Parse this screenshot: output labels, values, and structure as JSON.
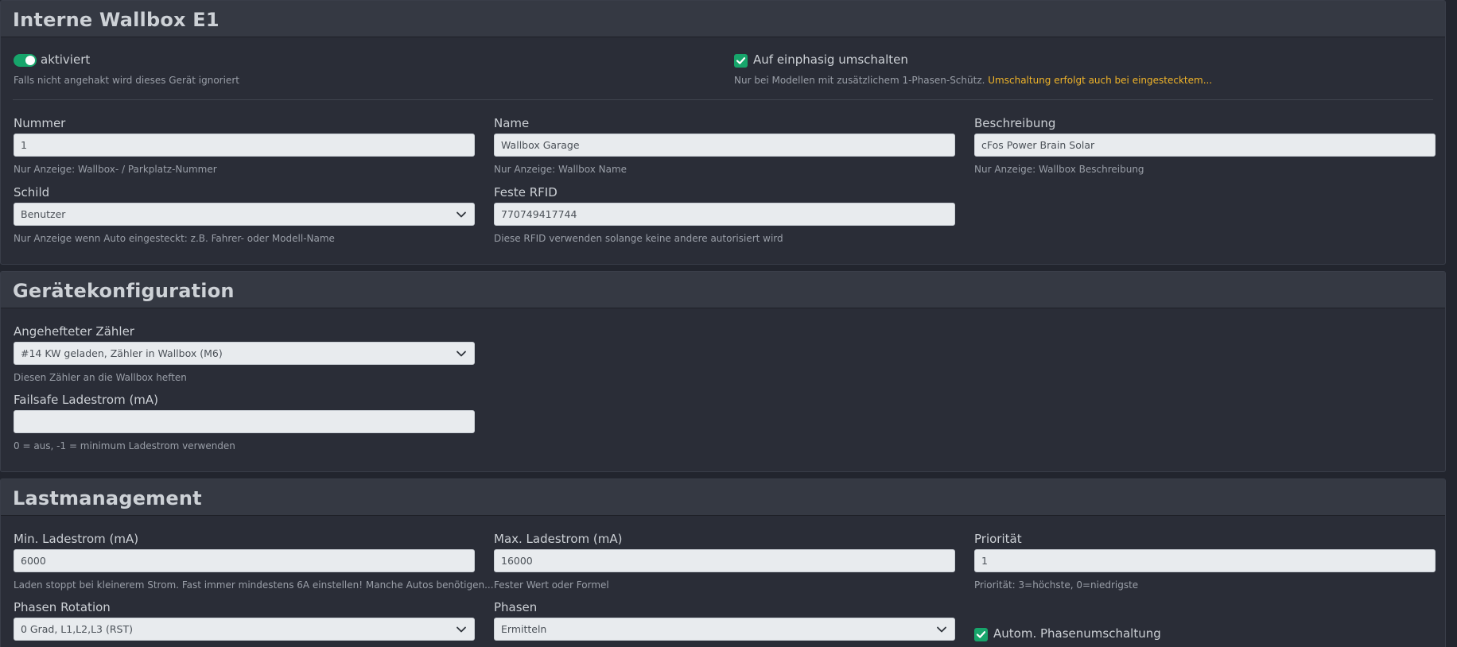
{
  "section1": {
    "title": "Interne Wallbox E1",
    "enabled": {
      "label": "aktiviert",
      "hint": "Falls nicht angehakt wird dieses Gerät ignoriert",
      "checked": true
    },
    "single_phase": {
      "label": "Auf einphasig umschalten",
      "hint": "Nur bei Modellen mit zusätzlichem 1-Phasen-Schütz.",
      "hint_warning": "Umschaltung erfolgt auch bei eingestecktem...",
      "checked": true
    },
    "nummer": {
      "label": "Nummer",
      "value": "1",
      "hint": "Nur Anzeige: Wallbox- / Parkplatz-Nummer"
    },
    "name": {
      "label": "Name",
      "value": "Wallbox Garage",
      "hint": "Nur Anzeige: Wallbox Name"
    },
    "beschreibung": {
      "label": "Beschreibung",
      "value": "cFos Power Brain Solar",
      "hint": "Nur Anzeige: Wallbox Beschreibung"
    },
    "schild": {
      "label": "Schild",
      "value": "Benutzer",
      "hint": "Nur Anzeige wenn Auto eingesteckt: z.B. Fahrer- oder Modell-Name"
    },
    "rfid": {
      "label": "Feste RFID",
      "value": "770749417744",
      "hint": "Diese RFID verwenden solange keine andere autorisiert wird"
    }
  },
  "section2": {
    "title": "Gerätekonfiguration",
    "meter": {
      "label": "Angehefteter Zähler",
      "value": "#14 KW geladen, Zähler in Wallbox (M6)",
      "hint": "Diesen Zähler an die Wallbox heften"
    },
    "failsafe": {
      "label": "Failsafe Ladestrom (mA)",
      "value": "",
      "hint": "0 = aus, -1 = minimum Ladestrom verwenden"
    }
  },
  "section3": {
    "title": "Lastmanagement",
    "min_current": {
      "label": "Min. Ladestrom (mA)",
      "value": "6000",
      "hint": "Laden stoppt bei kleinerem Strom. Fast immer mindestens 6A einstellen! Manche Autos benötigen..."
    },
    "max_current": {
      "label": "Max. Ladestrom (mA)",
      "value": "16000",
      "hint": "Fester Wert oder Formel"
    },
    "priority": {
      "label": "Priorität",
      "value": "1",
      "hint": "Priorität: 3=höchste, 0=niedrigste"
    },
    "phase_rotation": {
      "label": "Phasen Rotation",
      "value": "0 Grad, L1,L2,L3 (RST)"
    },
    "phases": {
      "label": "Phasen",
      "value": "Ermitteln"
    },
    "auto_phase_switch": {
      "label": "Autom. Phasenumschaltung",
      "checked": true
    }
  },
  "colors": {
    "background": "#22252e",
    "card": "#2a2d37",
    "header": "#353943",
    "accent_green": "#17a56b",
    "warning": "#f0b429",
    "input_bg": "#e8ebee"
  }
}
